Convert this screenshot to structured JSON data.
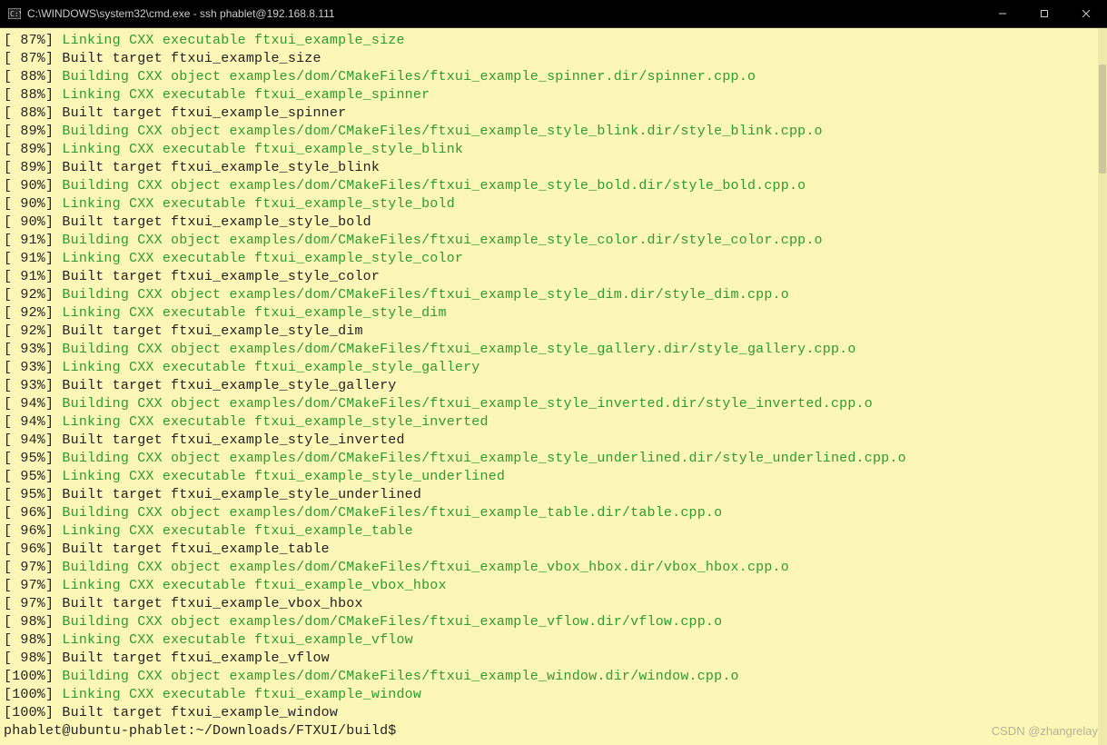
{
  "window": {
    "title": "C:\\WINDOWS\\system32\\cmd.exe - ssh  phablet@192.168.8.111",
    "controls": {
      "minimize": "—",
      "maximize": "▢",
      "close": "✕"
    }
  },
  "lines": [
    {
      "pct": " 87%",
      "style": "green",
      "text": "Linking CXX executable ftxui_example_size"
    },
    {
      "pct": " 87%",
      "style": "plain",
      "text": "Built target ftxui_example_size"
    },
    {
      "pct": " 88%",
      "style": "green",
      "text": "Building CXX object examples/dom/CMakeFiles/ftxui_example_spinner.dir/spinner.cpp.o"
    },
    {
      "pct": " 88%",
      "style": "green",
      "text": "Linking CXX executable ftxui_example_spinner"
    },
    {
      "pct": " 88%",
      "style": "plain",
      "text": "Built target ftxui_example_spinner"
    },
    {
      "pct": " 89%",
      "style": "green",
      "text": "Building CXX object examples/dom/CMakeFiles/ftxui_example_style_blink.dir/style_blink.cpp.o"
    },
    {
      "pct": " 89%",
      "style": "green",
      "text": "Linking CXX executable ftxui_example_style_blink"
    },
    {
      "pct": " 89%",
      "style": "plain",
      "text": "Built target ftxui_example_style_blink"
    },
    {
      "pct": " 90%",
      "style": "green",
      "text": "Building CXX object examples/dom/CMakeFiles/ftxui_example_style_bold.dir/style_bold.cpp.o"
    },
    {
      "pct": " 90%",
      "style": "green",
      "text": "Linking CXX executable ftxui_example_style_bold"
    },
    {
      "pct": " 90%",
      "style": "plain",
      "text": "Built target ftxui_example_style_bold"
    },
    {
      "pct": " 91%",
      "style": "green",
      "text": "Building CXX object examples/dom/CMakeFiles/ftxui_example_style_color.dir/style_color.cpp.o"
    },
    {
      "pct": " 91%",
      "style": "green",
      "text": "Linking CXX executable ftxui_example_style_color"
    },
    {
      "pct": " 91%",
      "style": "plain",
      "text": "Built target ftxui_example_style_color"
    },
    {
      "pct": " 92%",
      "style": "green",
      "text": "Building CXX object examples/dom/CMakeFiles/ftxui_example_style_dim.dir/style_dim.cpp.o"
    },
    {
      "pct": " 92%",
      "style": "green",
      "text": "Linking CXX executable ftxui_example_style_dim"
    },
    {
      "pct": " 92%",
      "style": "plain",
      "text": "Built target ftxui_example_style_dim"
    },
    {
      "pct": " 93%",
      "style": "green",
      "text": "Building CXX object examples/dom/CMakeFiles/ftxui_example_style_gallery.dir/style_gallery.cpp.o"
    },
    {
      "pct": " 93%",
      "style": "green",
      "text": "Linking CXX executable ftxui_example_style_gallery"
    },
    {
      "pct": " 93%",
      "style": "plain",
      "text": "Built target ftxui_example_style_gallery"
    },
    {
      "pct": " 94%",
      "style": "green",
      "text": "Building CXX object examples/dom/CMakeFiles/ftxui_example_style_inverted.dir/style_inverted.cpp.o"
    },
    {
      "pct": " 94%",
      "style": "green",
      "text": "Linking CXX executable ftxui_example_style_inverted"
    },
    {
      "pct": " 94%",
      "style": "plain",
      "text": "Built target ftxui_example_style_inverted"
    },
    {
      "pct": " 95%",
      "style": "green",
      "text": "Building CXX object examples/dom/CMakeFiles/ftxui_example_style_underlined.dir/style_underlined.cpp.o"
    },
    {
      "pct": " 95%",
      "style": "green",
      "text": "Linking CXX executable ftxui_example_style_underlined"
    },
    {
      "pct": " 95%",
      "style": "plain",
      "text": "Built target ftxui_example_style_underlined"
    },
    {
      "pct": " 96%",
      "style": "green",
      "text": "Building CXX object examples/dom/CMakeFiles/ftxui_example_table.dir/table.cpp.o"
    },
    {
      "pct": " 96%",
      "style": "green",
      "text": "Linking CXX executable ftxui_example_table"
    },
    {
      "pct": " 96%",
      "style": "plain",
      "text": "Built target ftxui_example_table"
    },
    {
      "pct": " 97%",
      "style": "green",
      "text": "Building CXX object examples/dom/CMakeFiles/ftxui_example_vbox_hbox.dir/vbox_hbox.cpp.o"
    },
    {
      "pct": " 97%",
      "style": "green",
      "text": "Linking CXX executable ftxui_example_vbox_hbox"
    },
    {
      "pct": " 97%",
      "style": "plain",
      "text": "Built target ftxui_example_vbox_hbox"
    },
    {
      "pct": " 98%",
      "style": "green",
      "text": "Building CXX object examples/dom/CMakeFiles/ftxui_example_vflow.dir/vflow.cpp.o"
    },
    {
      "pct": " 98%",
      "style": "green",
      "text": "Linking CXX executable ftxui_example_vflow"
    },
    {
      "pct": " 98%",
      "style": "plain",
      "text": "Built target ftxui_example_vflow"
    },
    {
      "pct": "100%",
      "style": "green",
      "text": "Building CXX object examples/dom/CMakeFiles/ftxui_example_window.dir/window.cpp.o"
    },
    {
      "pct": "100%",
      "style": "green",
      "text": "Linking CXX executable ftxui_example_window"
    },
    {
      "pct": "100%",
      "style": "plain",
      "text": "Built target ftxui_example_window"
    }
  ],
  "prompt": "phablet@ubuntu-phablet:~/Downloads/FTXUI/build$",
  "watermark": "CSDN @zhangrelay"
}
